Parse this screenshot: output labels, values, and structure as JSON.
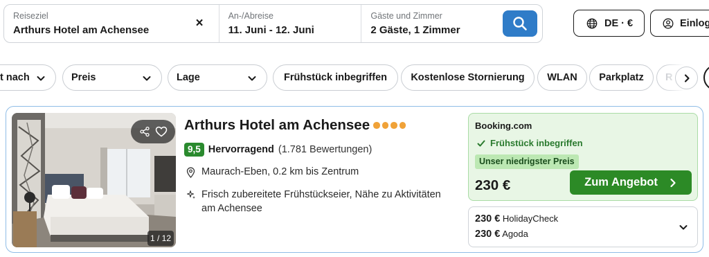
{
  "search": {
    "destination_label": "Reiseziel",
    "destination_value": "Arthurs Hotel am Achensee",
    "clear_icon": "×",
    "dates_label": "An-/Abreise",
    "dates_value": "11. Juni - 12. Juni",
    "guests_label": "Gäste und Zimmer",
    "guests_value": "2 Gäste, 1 Zimmer"
  },
  "header": {
    "language_label": "DE · €",
    "login_label": "Einlog"
  },
  "filters": {
    "sort_label": "t nach",
    "price_label": "Preis",
    "location_label": "Lage",
    "breakfast_label": "Frühstück inbegriffen",
    "cancellation_label": "Kostenlose Stornierung",
    "wifi_label": "WLAN",
    "parking_label": "Parkplatz",
    "faded_label": "R"
  },
  "hotel": {
    "name": "Arthurs Hotel am Achensee",
    "stars": 4,
    "rating_score": "9,5",
    "rating_text": "Hervorragend",
    "review_count": "(1.781 Bewertungen)",
    "location": "Maurach-Eben, 0.2 km bis Zentrum",
    "feature": "Frisch zubereitete Frühstückseier, Nähe zu Aktivitäten am Achensee",
    "photo_counter": "1 / 12"
  },
  "offer": {
    "provider": "Booking.com",
    "breakfast": "Frühstück inbegriffen",
    "badge": "Unser niedrigster Preis",
    "price": "230 €",
    "cta_label": "Zum Angebot"
  },
  "alternatives": [
    {
      "price": "230 €",
      "provider": "HolidayCheck"
    },
    {
      "price": "230 €",
      "provider": "Agoda"
    }
  ],
  "colors": {
    "search_button": "#2f7cc8",
    "rating_badge": "#2a8a2e",
    "cta_button": "#2c8a26",
    "offer_background": "#e8f6e5",
    "star": "#f0a238",
    "card_border": "#8fbce6"
  },
  "icons": {
    "search_button": "search-icon",
    "language": "globe-icon",
    "login": "user-icon",
    "share": "share-icon",
    "favorite": "heart-icon",
    "location": "map-pin-icon",
    "feature": "sparkle-icon",
    "check": "check-icon",
    "cta": "chevron-right-icon",
    "alt_expand": "chevron-down-icon"
  }
}
